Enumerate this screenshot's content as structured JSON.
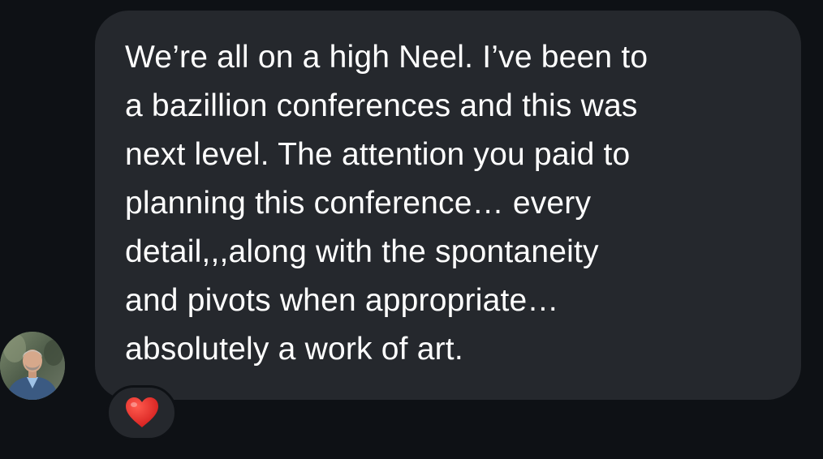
{
  "message": {
    "lines": [
      "We’re all on a high Neel. I’ve been to",
      "a bazillion conferences and this was",
      "next level. The attention you paid to",
      "planning this conference… every",
      "detail,,,along with the spontaneity",
      "and pivots when appropriate…",
      "absolutely a work of art."
    ],
    "bubble_color": "#25282d",
    "text_color": "#ffffff"
  },
  "reaction": {
    "icon": "heart-icon",
    "color": "#e0201f"
  },
  "sender": {
    "avatar": "avatar"
  },
  "theme": {
    "background": "#0e1115"
  }
}
